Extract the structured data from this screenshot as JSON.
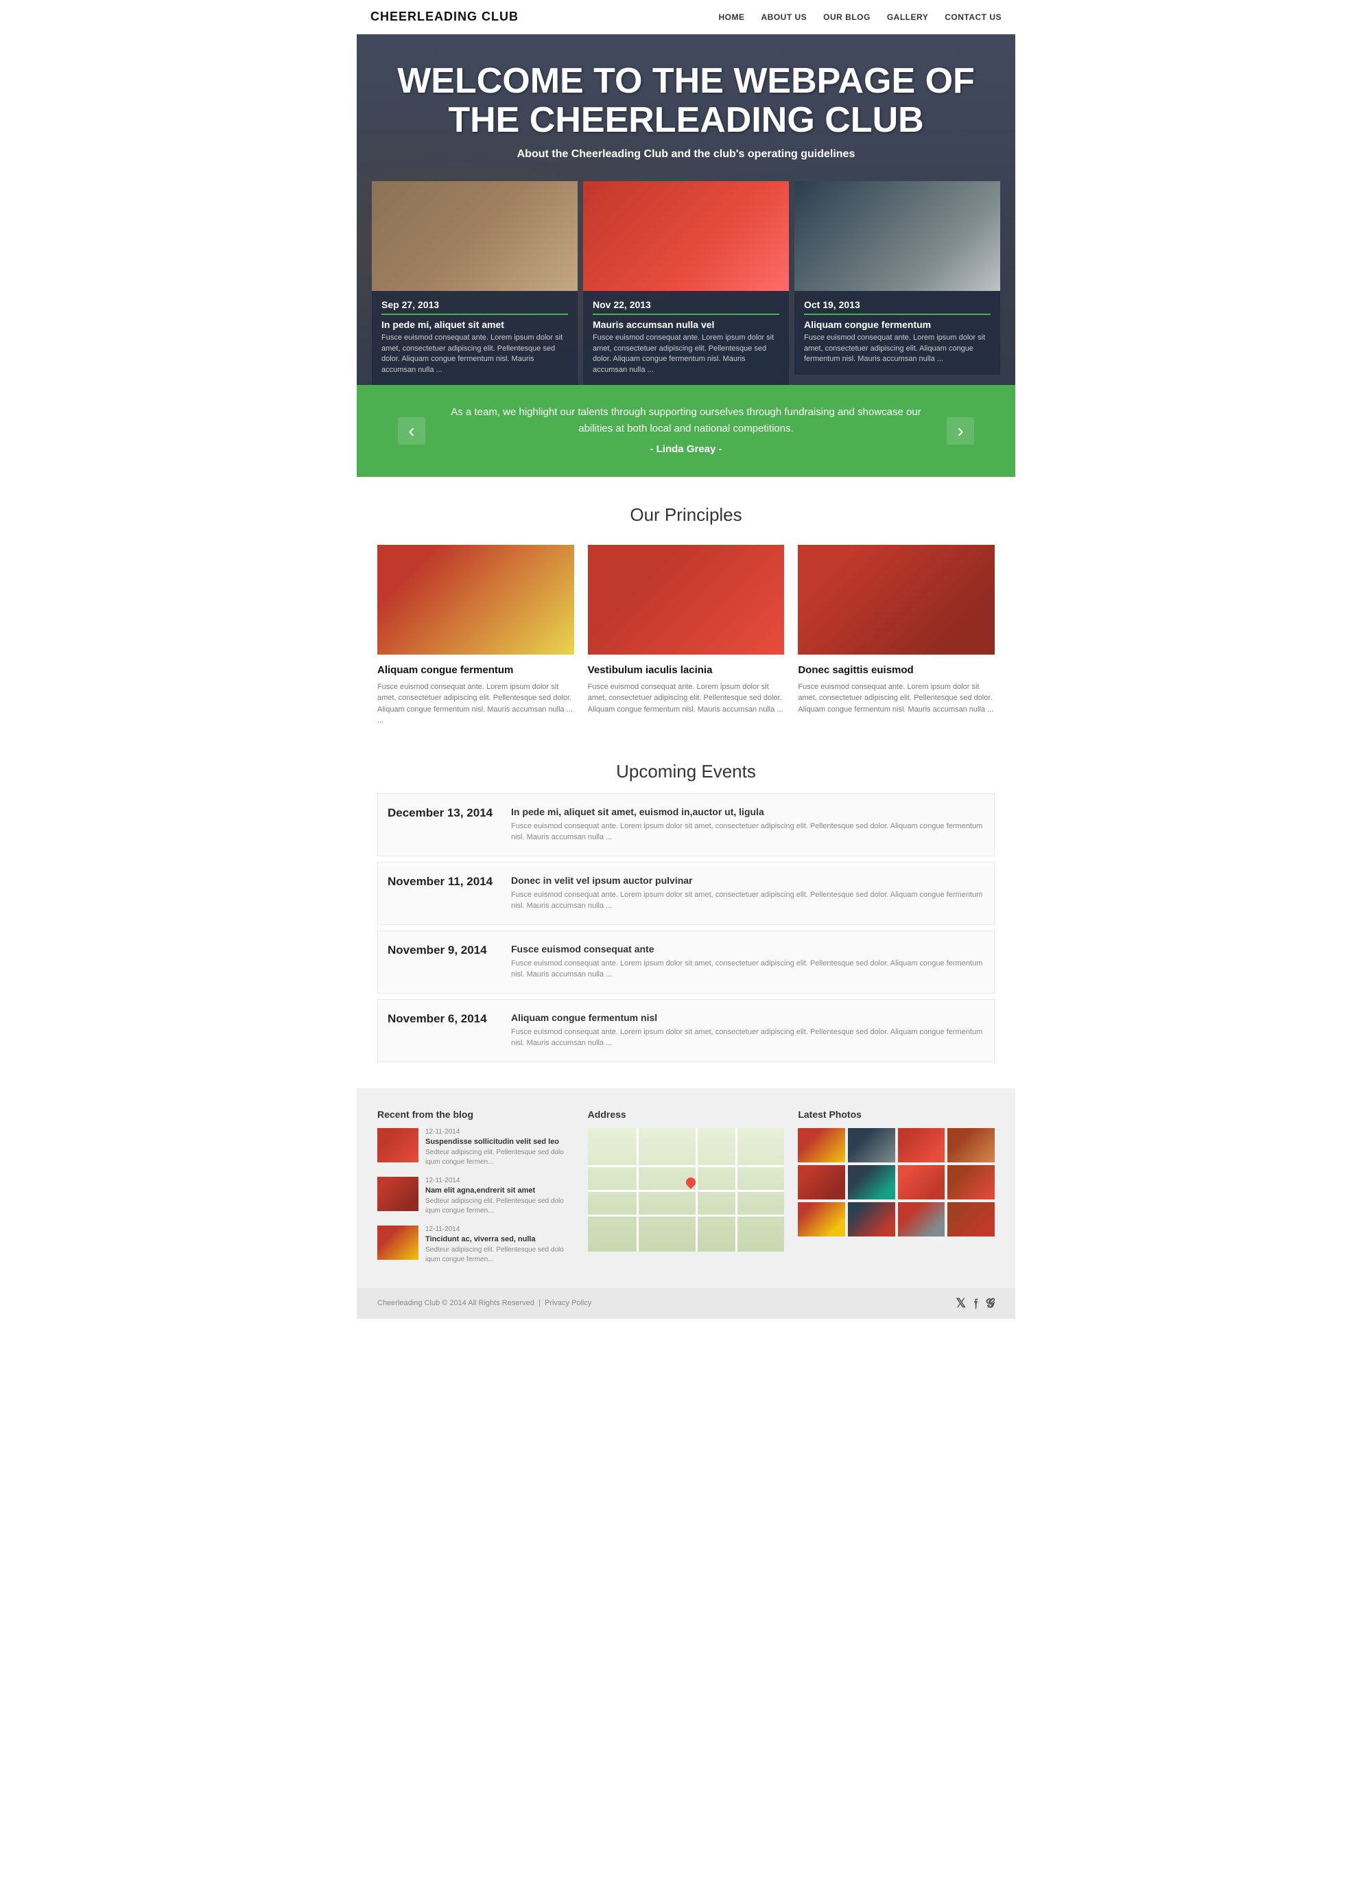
{
  "header": {
    "logo": "CHEERLEADING CLUB",
    "nav": [
      {
        "label": "HOME",
        "href": "#"
      },
      {
        "label": "ABOUT US",
        "href": "#"
      },
      {
        "label": "OUR BLOG",
        "href": "#"
      },
      {
        "label": "GALLERY",
        "href": "#"
      },
      {
        "label": "CONTACT US",
        "href": "#"
      }
    ]
  },
  "hero": {
    "title": "WELCOME TO THE WEBPAGE OF THE CHEERLEADING CLUB",
    "subtitle": "About the Cheerleading Club and the club's operating guidelines",
    "posts": [
      {
        "date": "Sep 27, 2013",
        "title": "In pede mi, aliquet sit amet",
        "excerpt": "Fusce euismod consequat ante. Lorem ipsum dolor sit amet, consectetuer adipiscing elit. Pellentesque sed dolor. Aliquam congue fermentum nisl. Mauris accumsan nulla ..."
      },
      {
        "date": "Nov 22, 2013",
        "title": "Mauris accumsan nulla vel",
        "excerpt": "Fusce euismod consequat ante. Lorem ipsum dolor sit amet, consectetuer adipiscing elit. Pellentesque sed dolor. Aliquam congue fermentum nisl. Mauris accumsan nulla ..."
      },
      {
        "date": "Oct 19, 2013",
        "title": "Aliquam congue fermentum",
        "excerpt": "Fusce euismod consequat ante. Lorem ipsum dolor sit amet, consectetuer adipiscing elit. Aliquam congue fermentum nisl. Mauris accumsan nulla ..."
      }
    ]
  },
  "quote": {
    "text": "As a team, we highlight our talents through supporting ourselves through fundraising and showcase our abilities at both local and national competitions.",
    "author": "- Linda Greay -"
  },
  "principles": {
    "section_title": "Our Principles",
    "items": [
      {
        "title": "Aliquam congue fermentum",
        "text": "Fusce euismod consequat ante. Lorem ipsum dolor sit amet, consectetuer adipiscing elit. Pellentesque sed dolor. Aliquam congue fermentum nisl. Mauris accumsan nulla ... "
      },
      {
        "title": "Vestibulum iaculis lacinia",
        "text": "Fusce euismod consequat ante. Lorem ipsum dolor sit amet, consectetuer adipiscing elit. Pellentesque sed dolor. Aliquam congue fermentum nisl. Mauris accumsan nulla ..."
      },
      {
        "title": "Donec sagittis euismod",
        "text": "Fusce euismod consequat ante. Lorem ipsum dolor sit amet, consectetuer adipiscing elit. Pellentesque sed dolor. Aliquam congue fermentum nisl. Mauris accumsan nulla ..."
      }
    ]
  },
  "events": {
    "section_title": "Upcoming Events",
    "items": [
      {
        "date": "December 13, 2014",
        "title": "In pede mi, aliquet sit amet, euismod in,auctor ut, ligula",
        "excerpt": "Fusce euismod consequat ante. Lorem ipsum dolor sit amet, consectetuer adipiscing elit. Pellentesque sed dolor. Aliquam congue fermentum nisl. Mauris accumsan nulla ..."
      },
      {
        "date": "November 11, 2014",
        "title": "Donec in velit vel ipsum auctor pulvinar",
        "excerpt": "Fusce euismod consequat ante. Lorem ipsum dolor sit amet, consectetuer adipiscing elit. Pellentesque sed dolor. Aliquam congue fermentum nisl. Mauris accumsan nulla ..."
      },
      {
        "date": "November 9, 2014",
        "title": "Fusce euismod consequat ante",
        "excerpt": "Fusce euismod consequat ante. Lorem ipsum dolor sit amet, consectetuer adipiscing elit. Pellentesque sed dolor. Aliquam congue fermentum nisl. Mauris accumsan nulla ..."
      },
      {
        "date": "November 6, 2014",
        "title": "Aliquam congue fermentum nisl",
        "excerpt": "Fusce euismod consequat ante. Lorem ipsum dolor sit amet, consectetuer adipiscing elit. Pellentesque sed dolor. Aliquam congue fermentum nisl. Mauris accumsan nulla ..."
      }
    ]
  },
  "footer": {
    "blog_title": "Recent from the blog",
    "blog_posts": [
      {
        "date": "12-11-2014",
        "title": "Suspendisse sollicitudin velit sed leo",
        "excerpt": "Sedteur adipiscing elit. Pellentesque sed dolo iqum congue fermen..."
      },
      {
        "date": "12-11-2014",
        "title": "Nam elit agna,endrerit sit amet",
        "excerpt": "Sedteur adipiscing elit. Pellentesque sed dolo iqum congue fermen..."
      },
      {
        "date": "12-11-2014",
        "title": "Tincidunt ac, viverra sed, nulla",
        "excerpt": "Sedteur adipiscing elit. Pellentesque sed dolo iqum congue fermen..."
      }
    ],
    "address_title": "Address",
    "photos_title": "Latest Photos",
    "copy": "Cheerleading Club © 2014 All Rights Reserved",
    "privacy": "Privacy Policy",
    "social": [
      "twitter",
      "facebook",
      "google-plus"
    ]
  }
}
